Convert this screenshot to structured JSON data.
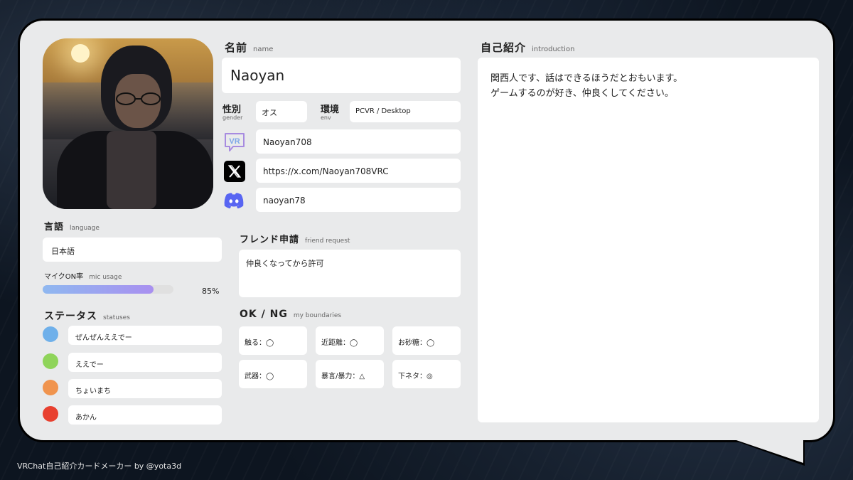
{
  "name": {
    "label": "名前",
    "label_en": "name",
    "value": "Naoyan"
  },
  "gender": {
    "label": "性別",
    "label_en": "gender",
    "value": "オス"
  },
  "env": {
    "label": "環境",
    "label_en": "env",
    "value": "PCVR / Desktop"
  },
  "accounts": {
    "vrchat": {
      "icon": "vrchat-icon",
      "value": "Naoyan708"
    },
    "x": {
      "icon": "x-icon",
      "value": "https://x.com/Naoyan708VRC"
    },
    "discord": {
      "icon": "discord-icon",
      "value": "naoyan78"
    }
  },
  "language": {
    "label": "言語",
    "label_en": "language",
    "value": "日本語"
  },
  "mic": {
    "label": "マイクON率",
    "label_en": "mic usage",
    "percent": 85,
    "percent_text": "85%"
  },
  "statuses": {
    "label": "ステータス",
    "label_en": "statuses",
    "items": [
      {
        "color": "#6fb0ea",
        "text": "ぜんぜんええでー"
      },
      {
        "color": "#8fd45a",
        "text": "ええでー"
      },
      {
        "color": "#f0944e",
        "text": "ちょいまち"
      },
      {
        "color": "#e8402f",
        "text": "あかん"
      }
    ]
  },
  "friend_request": {
    "label": "フレンド申請",
    "label_en": "friend request",
    "value": "仲良くなってから許可"
  },
  "boundaries": {
    "label": "OK / NG",
    "label_en": "my boundaries",
    "items": [
      "触る：◯",
      "近距離：◯",
      "お砂糖：◯",
      "武器：◯",
      "暴言/暴力：△",
      "下ネタ：◎"
    ]
  },
  "introduction": {
    "label": "自己紹介",
    "label_en": "introduction",
    "lines": [
      "関西人です、話はできるほうだとおもいます。",
      "ゲームするのが好き、仲良くしてください。"
    ]
  },
  "footer": "VRChat自己紹介カードメーカー by @yota3d"
}
